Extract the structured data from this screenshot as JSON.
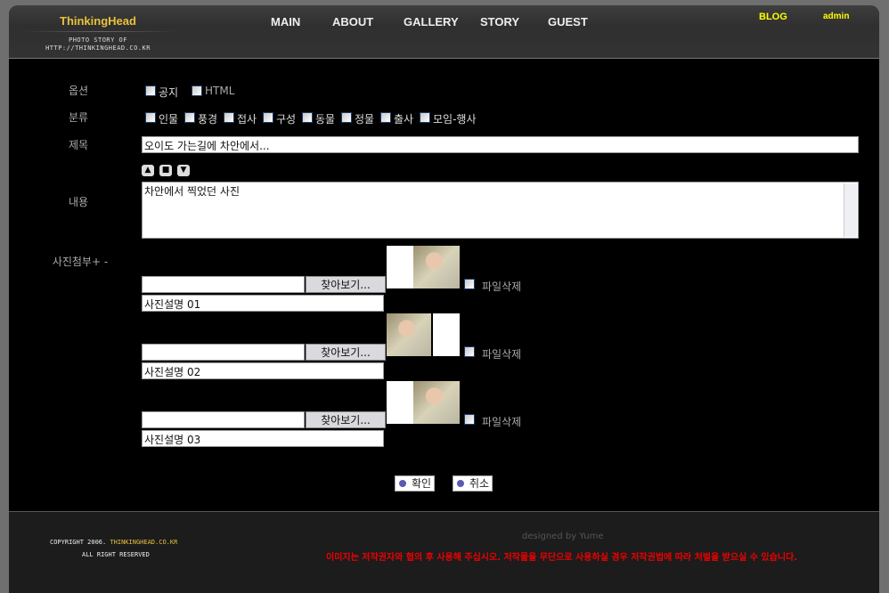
{
  "header": {
    "logo": "ThinkingHead",
    "tagline1": "PHOTO STORY OF",
    "tagline2": "HTTP://THINKINGHEAD.CO.KR",
    "nav": [
      "MAIN",
      "ABOUT",
      "GALLERY",
      "STORY",
      "GUEST"
    ],
    "blog": "BLOG",
    "admin": "admin"
  },
  "form": {
    "option_label": "옵션",
    "options": [
      "공지",
      "HTML"
    ],
    "category_label": "분류",
    "categories": [
      "인물",
      "풍경",
      "접사",
      "구성",
      "동물",
      "정물",
      "출사",
      "모임-행사"
    ],
    "title_label": "제목",
    "title_value": "오이도 가는길에 차안에서...",
    "content_label": "내용",
    "content_value": "차안에서 찍었던 사진",
    "attach_label": "사진첨부+ -",
    "browse_label": "찾아보기...",
    "delete_label": "파일삭제",
    "photos": [
      {
        "desc": "사진설명 01"
      },
      {
        "desc": "사진설명 02"
      },
      {
        "desc": "사진설명 03"
      }
    ],
    "confirm": "확인",
    "cancel": "취소"
  },
  "footer": {
    "copyright_prefix": "COPYRIGHT 2006.",
    "copyright_site": "THINKINGHEAD.CO.KR",
    "rights": "ALL RIGHT RESERVED",
    "designer": "designed by Yume",
    "notice": "이미지는 저작권자와 협의 후 사용해 주십시오. 저작물을 무단으로 사용하실 경우 저작권법에 따라 처벌을 받으실 수 있습니다."
  }
}
